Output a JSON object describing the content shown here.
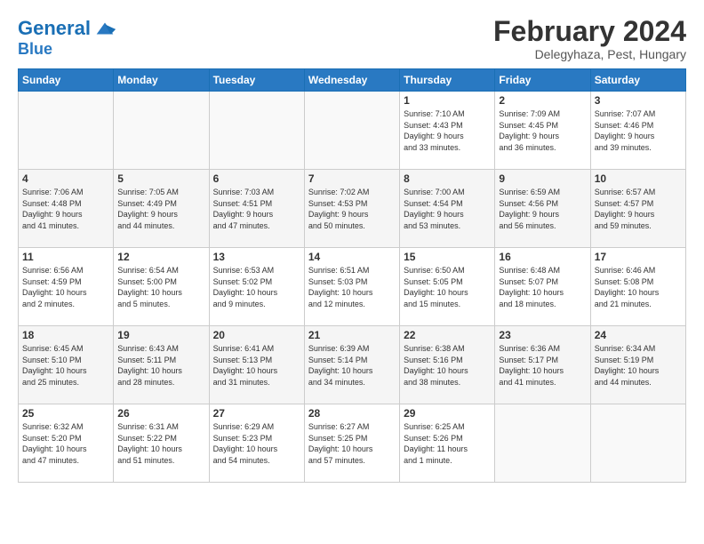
{
  "logo": {
    "line1": "General",
    "line2": "Blue"
  },
  "title": "February 2024",
  "subtitle": "Delegyhaza, Pest, Hungary",
  "days_header": [
    "Sunday",
    "Monday",
    "Tuesday",
    "Wednesday",
    "Thursday",
    "Friday",
    "Saturday"
  ],
  "weeks": [
    [
      {
        "day": "",
        "info": ""
      },
      {
        "day": "",
        "info": ""
      },
      {
        "day": "",
        "info": ""
      },
      {
        "day": "",
        "info": ""
      },
      {
        "day": "1",
        "info": "Sunrise: 7:10 AM\nSunset: 4:43 PM\nDaylight: 9 hours\nand 33 minutes."
      },
      {
        "day": "2",
        "info": "Sunrise: 7:09 AM\nSunset: 4:45 PM\nDaylight: 9 hours\nand 36 minutes."
      },
      {
        "day": "3",
        "info": "Sunrise: 7:07 AM\nSunset: 4:46 PM\nDaylight: 9 hours\nand 39 minutes."
      }
    ],
    [
      {
        "day": "4",
        "info": "Sunrise: 7:06 AM\nSunset: 4:48 PM\nDaylight: 9 hours\nand 41 minutes."
      },
      {
        "day": "5",
        "info": "Sunrise: 7:05 AM\nSunset: 4:49 PM\nDaylight: 9 hours\nand 44 minutes."
      },
      {
        "day": "6",
        "info": "Sunrise: 7:03 AM\nSunset: 4:51 PM\nDaylight: 9 hours\nand 47 minutes."
      },
      {
        "day": "7",
        "info": "Sunrise: 7:02 AM\nSunset: 4:53 PM\nDaylight: 9 hours\nand 50 minutes."
      },
      {
        "day": "8",
        "info": "Sunrise: 7:00 AM\nSunset: 4:54 PM\nDaylight: 9 hours\nand 53 minutes."
      },
      {
        "day": "9",
        "info": "Sunrise: 6:59 AM\nSunset: 4:56 PM\nDaylight: 9 hours\nand 56 minutes."
      },
      {
        "day": "10",
        "info": "Sunrise: 6:57 AM\nSunset: 4:57 PM\nDaylight: 9 hours\nand 59 minutes."
      }
    ],
    [
      {
        "day": "11",
        "info": "Sunrise: 6:56 AM\nSunset: 4:59 PM\nDaylight: 10 hours\nand 2 minutes."
      },
      {
        "day": "12",
        "info": "Sunrise: 6:54 AM\nSunset: 5:00 PM\nDaylight: 10 hours\nand 5 minutes."
      },
      {
        "day": "13",
        "info": "Sunrise: 6:53 AM\nSunset: 5:02 PM\nDaylight: 10 hours\nand 9 minutes."
      },
      {
        "day": "14",
        "info": "Sunrise: 6:51 AM\nSunset: 5:03 PM\nDaylight: 10 hours\nand 12 minutes."
      },
      {
        "day": "15",
        "info": "Sunrise: 6:50 AM\nSunset: 5:05 PM\nDaylight: 10 hours\nand 15 minutes."
      },
      {
        "day": "16",
        "info": "Sunrise: 6:48 AM\nSunset: 5:07 PM\nDaylight: 10 hours\nand 18 minutes."
      },
      {
        "day": "17",
        "info": "Sunrise: 6:46 AM\nSunset: 5:08 PM\nDaylight: 10 hours\nand 21 minutes."
      }
    ],
    [
      {
        "day": "18",
        "info": "Sunrise: 6:45 AM\nSunset: 5:10 PM\nDaylight: 10 hours\nand 25 minutes."
      },
      {
        "day": "19",
        "info": "Sunrise: 6:43 AM\nSunset: 5:11 PM\nDaylight: 10 hours\nand 28 minutes."
      },
      {
        "day": "20",
        "info": "Sunrise: 6:41 AM\nSunset: 5:13 PM\nDaylight: 10 hours\nand 31 minutes."
      },
      {
        "day": "21",
        "info": "Sunrise: 6:39 AM\nSunset: 5:14 PM\nDaylight: 10 hours\nand 34 minutes."
      },
      {
        "day": "22",
        "info": "Sunrise: 6:38 AM\nSunset: 5:16 PM\nDaylight: 10 hours\nand 38 minutes."
      },
      {
        "day": "23",
        "info": "Sunrise: 6:36 AM\nSunset: 5:17 PM\nDaylight: 10 hours\nand 41 minutes."
      },
      {
        "day": "24",
        "info": "Sunrise: 6:34 AM\nSunset: 5:19 PM\nDaylight: 10 hours\nand 44 minutes."
      }
    ],
    [
      {
        "day": "25",
        "info": "Sunrise: 6:32 AM\nSunset: 5:20 PM\nDaylight: 10 hours\nand 47 minutes."
      },
      {
        "day": "26",
        "info": "Sunrise: 6:31 AM\nSunset: 5:22 PM\nDaylight: 10 hours\nand 51 minutes."
      },
      {
        "day": "27",
        "info": "Sunrise: 6:29 AM\nSunset: 5:23 PM\nDaylight: 10 hours\nand 54 minutes."
      },
      {
        "day": "28",
        "info": "Sunrise: 6:27 AM\nSunset: 5:25 PM\nDaylight: 10 hours\nand 57 minutes."
      },
      {
        "day": "29",
        "info": "Sunrise: 6:25 AM\nSunset: 5:26 PM\nDaylight: 11 hours\nand 1 minute."
      },
      {
        "day": "",
        "info": ""
      },
      {
        "day": "",
        "info": ""
      }
    ]
  ]
}
